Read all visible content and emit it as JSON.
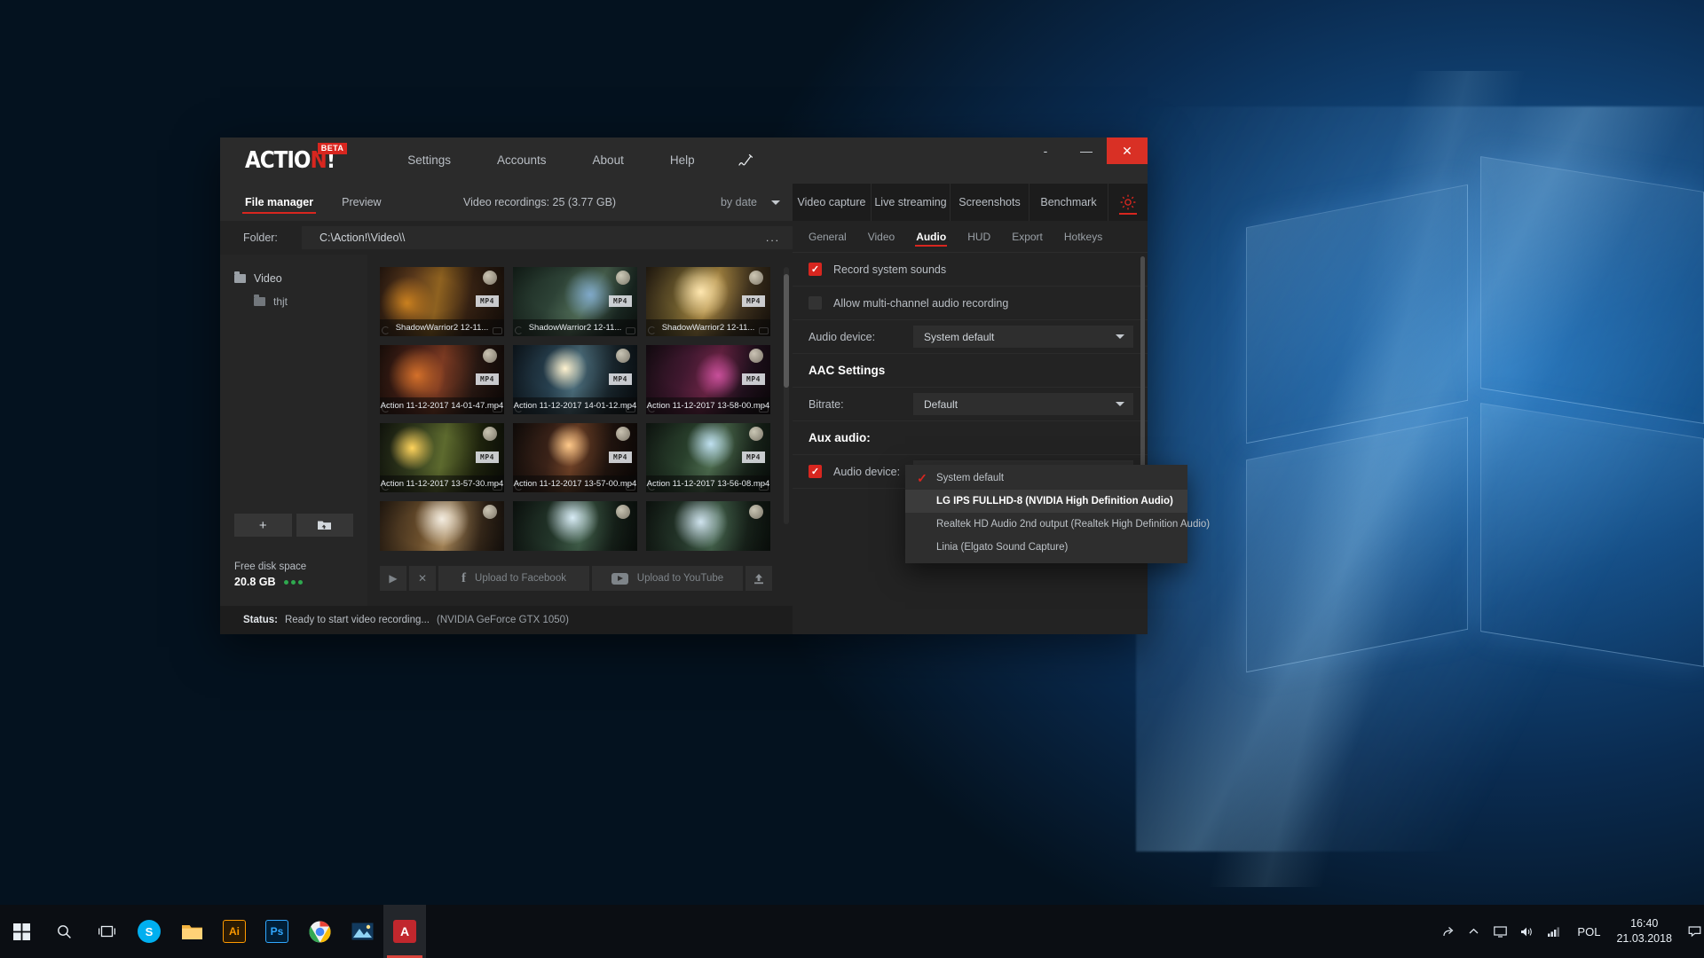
{
  "window": {
    "logo_left": "ACTIO",
    "logo_red": "N",
    "logo_right": "!",
    "beta_badge": "BETA",
    "menu": [
      {
        "label": "Settings"
      },
      {
        "label": "Accounts"
      },
      {
        "label": "About"
      },
      {
        "label": "Help"
      }
    ],
    "pen_icon": "pen-icon",
    "controls": {
      "help_dash": "-",
      "minimize": "—",
      "close": "✕"
    }
  },
  "left_panel": {
    "tabs": [
      {
        "label": "File manager",
        "active": true
      },
      {
        "label": "Preview",
        "active": false
      }
    ],
    "recordings_info": "Video recordings: 25 (3.77 GB)",
    "sort_value": "by date",
    "folder_label": "Folder:",
    "folder_path": "C:\\Action!\\Video\\\\",
    "folder_more": "...",
    "tree": [
      {
        "label": "Video",
        "level": 0
      },
      {
        "label": "thjt",
        "level": 1
      }
    ],
    "tree_buttons": [
      {
        "icon": "plus-icon",
        "label": "+"
      },
      {
        "icon": "folder-open-icon",
        "label": ""
      }
    ],
    "thumbnails": [
      {
        "name": "ShadowWarrior2 12-11...",
        "badge": "MP4"
      },
      {
        "name": "ShadowWarrior2 12-11...",
        "badge": "MP4"
      },
      {
        "name": "ShadowWarrior2 12-11...",
        "badge": "MP4"
      },
      {
        "name": "Action 11-12-2017 14-01-47.mp4",
        "badge": "MP4"
      },
      {
        "name": "Action 11-12-2017 14-01-12.mp4",
        "badge": "MP4"
      },
      {
        "name": "Action 11-12-2017 13-58-00.mp4",
        "badge": "MP4"
      },
      {
        "name": "Action 11-12-2017 13-57-30.mp4",
        "badge": "MP4"
      },
      {
        "name": "Action 11-12-2017 13-57-00.mp4",
        "badge": "MP4"
      },
      {
        "name": "Action 11-12-2017 13-56-08.mp4",
        "badge": "MP4"
      },
      {
        "name": "",
        "badge": ""
      },
      {
        "name": "",
        "badge": ""
      },
      {
        "name": "",
        "badge": ""
      }
    ],
    "disk": {
      "label": "Free disk space",
      "value": "20.8 GB"
    },
    "actions": {
      "play": "▶",
      "delete": "✕",
      "facebook_icon": "facebook-icon",
      "facebook_label": "Upload to Facebook",
      "youtube_icon": "youtube-icon",
      "youtube_label": "Upload to YouTube",
      "export_icon": "upload-icon"
    }
  },
  "status_bar": {
    "key": "Status:",
    "value": "Ready to start video recording...",
    "gpu": "(NVIDIA GeForce GTX 1050)"
  },
  "right_panel": {
    "tabs": [
      {
        "label": "Video capture",
        "active": false
      },
      {
        "label": "Live streaming",
        "active": false
      },
      {
        "label": "Screenshots",
        "active": false
      },
      {
        "label": "Benchmark",
        "active": false
      }
    ],
    "gear_icon": "gear-icon",
    "subtabs": [
      {
        "label": "General",
        "active": false
      },
      {
        "label": "Video",
        "active": false
      },
      {
        "label": "Audio",
        "active": true
      },
      {
        "label": "HUD",
        "active": false
      },
      {
        "label": "Export",
        "active": false
      },
      {
        "label": "Hotkeys",
        "active": false
      }
    ],
    "rows": {
      "record_system_sounds": {
        "label": "Record system sounds",
        "checked": true
      },
      "allow_multichannel": {
        "label": "Allow multi-channel audio recording",
        "checked": false
      },
      "audio_device": {
        "label": "Audio device:",
        "value": "System default"
      },
      "aac_section": "AAC Settings",
      "bitrate": {
        "label": "Bitrate:",
        "value": "Default"
      },
      "aux_section": "Aux audio:",
      "aux_audio_device": {
        "label": "Audio device:",
        "value": "System default",
        "checked": true
      }
    }
  },
  "dropdown": {
    "items": [
      {
        "label": "System default",
        "checked": true,
        "highlighted": false
      },
      {
        "label": "LG IPS FULLHD-8 (NVIDIA High Definition Audio)",
        "checked": false,
        "highlighted": true
      },
      {
        "label": "Realtek HD Audio 2nd output (Realtek High Definition Audio)",
        "checked": false,
        "highlighted": false
      },
      {
        "label": "Linia (Elgato Sound Capture)",
        "checked": false,
        "highlighted": false
      }
    ]
  },
  "taskbar": {
    "start_icon": "windows-start-icon",
    "search_icon": "search-icon",
    "taskview_icon": "task-view-icon",
    "apps": [
      {
        "name": "skype-icon",
        "glyph": "S",
        "color": "#00aff0",
        "active": false
      },
      {
        "name": "file-explorer-icon",
        "glyph": "📁",
        "color": "#f0b429",
        "active": false
      },
      {
        "name": "illustrator-icon",
        "glyph": "Ai",
        "color": "#2b1a03",
        "active": false
      },
      {
        "name": "photoshop-icon",
        "glyph": "Ps",
        "color": "#001e36",
        "active": false
      },
      {
        "name": "chrome-icon",
        "glyph": "●",
        "color": "#4285f4",
        "active": false
      },
      {
        "name": "picture-viewer-icon",
        "glyph": "▲",
        "color": "#2f6fa8",
        "active": false
      },
      {
        "name": "action-recorder-icon",
        "glyph": "A",
        "color": "#c1272d",
        "active": true
      }
    ],
    "tray": {
      "icons": [
        "share-icon",
        "chevron-up-icon",
        "monitor-icon",
        "speaker-icon",
        "network-icon"
      ],
      "language": "POL",
      "time": "16:40",
      "date": "21.03.2018",
      "notification_icon": "notification-icon"
    }
  },
  "colors": {
    "accent_red": "#d8261f",
    "window_bg": "#232323",
    "titlebar_bg": "#2b2b2b",
    "close_red": "#d93025",
    "disk_green": "#2fa94f"
  }
}
